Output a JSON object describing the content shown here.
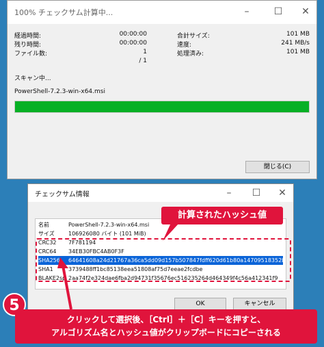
{
  "window1": {
    "title": "100% チェックサム計算中...",
    "minimize": "–",
    "maximize": "☐",
    "close": "✕",
    "elapsed_label": "経過時間:",
    "elapsed_value": "00:00:00",
    "remaining_label": "残り時間:",
    "remaining_value": "00:00:00",
    "files_label": "ファイル数:",
    "files_value": "1",
    "files_total": "/ 1",
    "total_size_label": "合計サイズ:",
    "total_size_value": "101 MB",
    "speed_label": "速度:",
    "speed_value": "241 MB/s",
    "processed_label": "処理済み:",
    "processed_value": "101 MB",
    "scanning_label": "スキャン中...",
    "file_name": "PowerShell-7.2.3-win-x64.msi",
    "progress_percent": 100,
    "close_button": "閉じる(C)"
  },
  "window2": {
    "title": "チェックサム情報",
    "minimize": "–",
    "maximize": "☐",
    "close": "✕",
    "rows": [
      {
        "key": "名前",
        "value": "PowerShell-7.2.3-win-x64.msi"
      },
      {
        "key": "サイズ",
        "value": "106926080 バイト (101 MiB)"
      },
      {
        "key": "CRC32",
        "value": "7F781194"
      },
      {
        "key": "CRC64",
        "value": "34EB30FBC4AB0F3F"
      },
      {
        "key": "SHA256",
        "value": "64641608a24d21767a36ca5dd09d157b507847fdff620d61b80a14709518352b"
      },
      {
        "key": "SHA1",
        "value": "3739488ff1bc85138eea51808af75d7eeae2fcdbe"
      },
      {
        "key": "BLAKE2sp",
        "value": "2aa74f2e324dae6fba2d94731f35676ec516235264d464349f4c56a412341f9"
      }
    ],
    "ok_button": "OK",
    "cancel_button": "キャンセル"
  },
  "annotations": {
    "hash_callout": "計算されたハッシュ値",
    "step_number": "5",
    "note_line1": "クリックして選択後、［Ctrl］＋［C］キーを押すと、",
    "note_line2": "アルゴリズム名とハッシュ値がクリップボードにコピーされる",
    "accent_color": "#e0143c"
  }
}
